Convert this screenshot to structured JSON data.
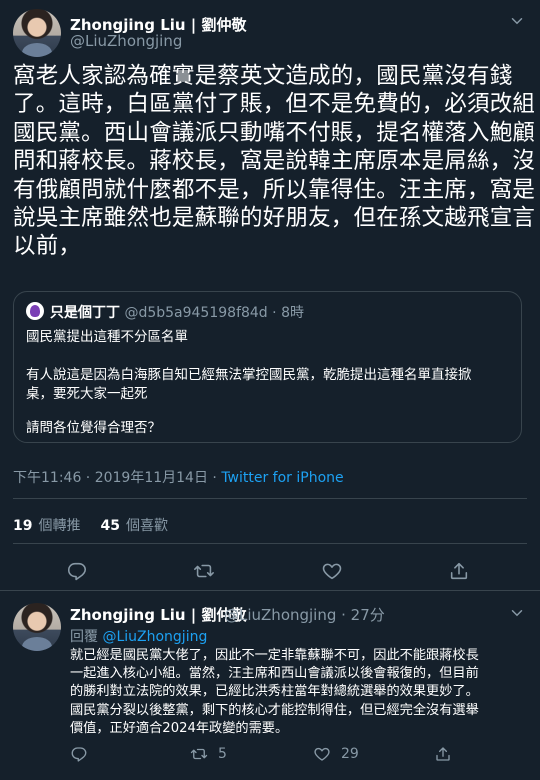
{
  "main_tweet": {
    "display_name": "Zhongjing Liu | 劉仲敬",
    "handle": "@LiuZhongjing",
    "text_lines": [
      "窩老人家認為確實是蔡英文造成的，國民黨沒有錢",
      "了。這時，白區黨付了賬，但不是免費的，必須改組",
      "國民黨。西山會議派只動嘴不付賬，提名權落入鮑顧",
      "問和蔣校長。蔣校長，窩是說韓主席原本是屌絲，沒",
      "有俄顧問就什麼都不是，所以靠得住。汪主席，窩是",
      "說吳主席雖然也是蘇聯的好朋友，但在孫文越飛宣言",
      "以前，"
    ],
    "quote": {
      "name": "只是個丁丁",
      "handle": "@d5b5a945198f84d",
      "time": "8時",
      "line1": "國民黨提出這種不分區名單",
      "line2": "有人說這是因為白海豚自知已經無法掌控國民黨，乾脆提出這種名單直接掀",
      "line3": "桌，要死大家一起死",
      "line4": "請問各位覺得合理否？"
    },
    "timestamp": "下午11:46 · 2019年11月14日 · ",
    "source": "Twitter for iPhone",
    "retweets_count": "19",
    "retweets_label": "個轉推",
    "likes_count": "45",
    "likes_label": "個喜歡"
  },
  "reply_tweet": {
    "display_name": "Zhongjing Liu | 劉仲敬",
    "handle": "@LiuZhongjing · 27分",
    "reply_prefix": "回覆 ",
    "reply_to": "@LiuZhongjing",
    "text_lines": [
      "就已經是國民黨大佬了，因此不一定非靠蘇聯不可，因此不能跟蔣校長",
      "一起進入核心小組。當然，汪主席和西山會議派以後會報復的，但目前",
      "的勝利對立法院的效果，已經比洪秀柱當年對總統選舉的效果更妙了。",
      "國民黨分裂以後整黨，剩下的核心才能控制得住，但已經完全沒有選舉",
      "價值，正好適合2024年政變的需要。"
    ],
    "retweets_count": "5",
    "likes_count": "29"
  },
  "icons": [
    "chevron-down-icon",
    "reply-icon",
    "retweet-icon",
    "like-icon",
    "share-icon"
  ],
  "colors": {
    "background": "#15202b",
    "accent": "#1da1f2",
    "muted": "#8899a6",
    "border": "#38444d"
  }
}
